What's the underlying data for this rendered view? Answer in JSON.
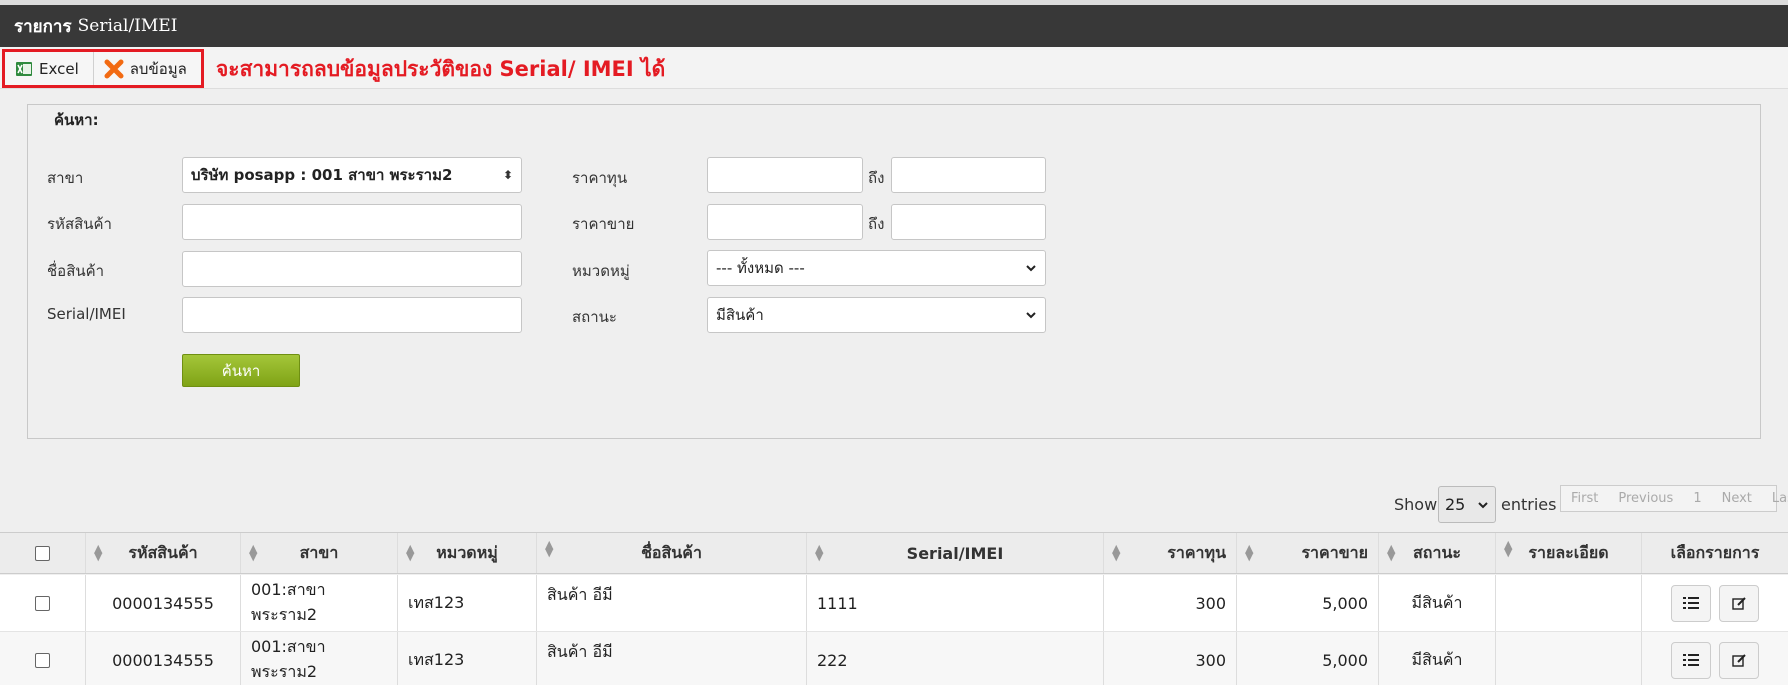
{
  "window": {
    "title_bold": "รายการ",
    "title_rest": "Serial/IMEI"
  },
  "toolbar": {
    "excel_label": "Excel",
    "delete_label": "ลบข้อมูล",
    "annotation": "จะสามารถลบข้อมูลประวัติของ Serial/ IMEI ได้",
    "accent": "#e41b23"
  },
  "search": {
    "legend": "ค้นหา:",
    "branch_label": "สาขา",
    "branch_value": "บริษัท posapp : 001 สาขา พระราม2",
    "product_code_label": "รหัสสินค้า",
    "product_code_value": "",
    "product_name_label": "ชื่อสินค้า",
    "product_name_value": "",
    "serial_label": "Serial/IMEI",
    "serial_value": "",
    "cost_label": "ราคาทุน",
    "cost_from": "",
    "cost_to": "",
    "price_label": "ราคาขาย",
    "price_from": "",
    "price_to": "",
    "to_label": "ถึง",
    "category_label": "หมวดหมู่",
    "category_value": "--- ทั้งหมด ---",
    "status_label": "สถานะ",
    "status_value": "มีสินค้า",
    "search_button": "ค้นหา"
  },
  "list": {
    "show_label": "Show",
    "entries_value": "25",
    "entries_label": "entries",
    "pager": {
      "first": "First",
      "previous": "Previous",
      "page": "1",
      "next": "Next",
      "last": "Last"
    }
  },
  "table": {
    "headers": {
      "code": "รหัสสินค้า",
      "branch": "สาขา",
      "category": "หมวดหมู่",
      "name": "ชื่อสินค้า",
      "serial": "Serial/IMEI",
      "cost": "ราคาทุน",
      "price": "ราคาขาย",
      "status": "สถานะ",
      "detail": "รายละเอียด",
      "actions": "เลือกรายการ"
    },
    "rows": [
      {
        "code": "0000134555",
        "branch": "001:สาขา พระราม2",
        "category": "เทส123",
        "name": "สินค้า อีมี",
        "serial": "1111",
        "cost": "300",
        "price": "5,000",
        "status": "มีสินค้า",
        "detail": ""
      },
      {
        "code": "0000134555",
        "branch": "001:สาขา พระราม2",
        "category": "เทส123",
        "name": "สินค้า อีมี",
        "serial": "222",
        "cost": "300",
        "price": "5,000",
        "status": "มีสินค้า",
        "detail": ""
      }
    ]
  }
}
